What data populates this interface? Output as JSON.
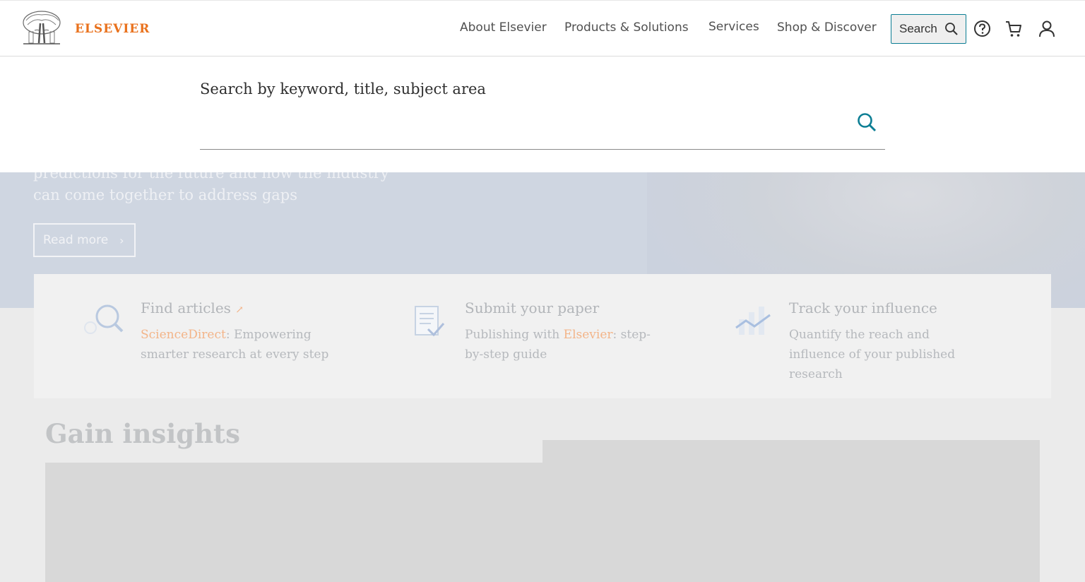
{
  "brand": {
    "name": "ELSEVIER",
    "color": "#e9711c"
  },
  "nav": [
    {
      "label": "About Elsevier"
    },
    {
      "label": "Products & Solutions"
    },
    {
      "label": "Services"
    },
    {
      "label": "Shop & Discover"
    }
  ],
  "header": {
    "search_label": "Search",
    "icons": [
      "help-icon",
      "cart-icon",
      "user-icon"
    ]
  },
  "search_panel": {
    "label": "Search by keyword, title, subject area",
    "value": "",
    "icon": "search-icon"
  },
  "hero": {
    "text": "predictions for the future and how the industry can come together to address gaps",
    "button_label": "Read more"
  },
  "features": [
    {
      "title": "Find articles",
      "title_suffix": "↗",
      "accent": "ScienceDirect",
      "desc_rest": ": Empowering smarter research at every step",
      "icon": "magnifier-icon"
    },
    {
      "title": "Submit your paper",
      "desc_prefix": "Publishing with ",
      "accent": "Elsevier",
      "desc_rest": ": step-by-step guide",
      "icon": "document-icon"
    },
    {
      "title": "Track your influence",
      "desc": "Quantify the reach and influence of your published research",
      "icon": "chart-icon"
    }
  ],
  "insights": {
    "heading": "Gain insights"
  },
  "colors": {
    "accent_teal": "#0c7e94",
    "accent_orange": "#e9711c"
  }
}
